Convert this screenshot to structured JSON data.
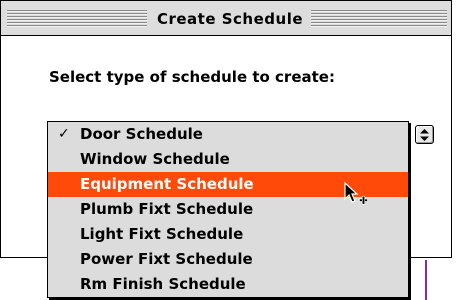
{
  "dialog": {
    "title": "Create Schedule",
    "prompt": "Select type of schedule to create:"
  },
  "schedule_menu": {
    "selected_index": 0,
    "highlighted_index": 2,
    "check_mark": "✓",
    "items": [
      "Door Schedule",
      "Window Schedule",
      "Equipment Schedule",
      "Plumb Fixt Schedule",
      "Light Fixt Schedule",
      "Power Fixt Schedule",
      "Rm Finish Schedule"
    ]
  },
  "colors": {
    "highlight": "#ff4a0a",
    "menu_background": "#dcdcdc",
    "title_bar": "#dddddd"
  },
  "icons": {
    "popup_button": "up-down-arrows-icon",
    "cursor": "arrow-copy-cursor-icon"
  }
}
